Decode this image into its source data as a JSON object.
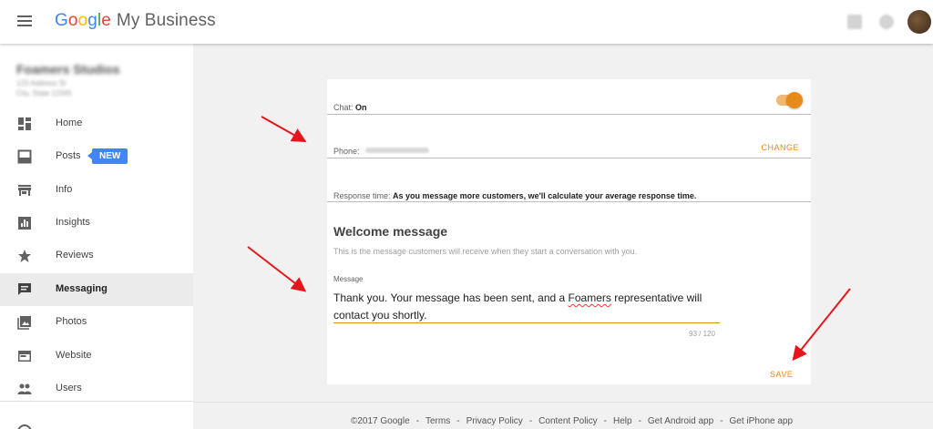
{
  "header": {
    "logo_google": [
      "G",
      "o",
      "o",
      "g",
      "l",
      "e"
    ],
    "product": "My Business",
    "icons": [
      "menu-icon",
      "apps-icon",
      "notifications-icon",
      "avatar"
    ]
  },
  "sidebar": {
    "items": [
      {
        "label": "Home",
        "icon": "dashboard-icon"
      },
      {
        "label": "Posts",
        "icon": "posts-icon",
        "badge": "NEW"
      },
      {
        "label": "Info",
        "icon": "storefront-icon"
      },
      {
        "label": "Insights",
        "icon": "bar-chart-icon"
      },
      {
        "label": "Reviews",
        "icon": "star-icon"
      },
      {
        "label": "Messaging",
        "icon": "chat-icon",
        "active": true
      },
      {
        "label": "Photos",
        "icon": "photo-icon"
      },
      {
        "label": "Website",
        "icon": "web-icon"
      },
      {
        "label": "Users",
        "icon": "people-icon"
      }
    ]
  },
  "card": {
    "chat_label": "Chat:",
    "chat_value": "On",
    "phone_label": "Phone:",
    "change_label": "CHANGE",
    "response_label": "Response time:",
    "response_value": "As you message more customers, we'll calculate your average response time.",
    "welcome_title": "Welcome message",
    "welcome_sub": "This is the message customers will receive when they start a conversation with you.",
    "message_label": "Message",
    "message_before": "Thank you. Your message has been sent, and a ",
    "message_misspelled": "Foamers",
    "message_after": " representative will contact you shortly.",
    "counter": "93 / 120",
    "save_label": "SAVE"
  },
  "footer": {
    "copyright": "©2017 Google",
    "links": [
      "Terms",
      "Privacy Policy",
      "Content Policy",
      "Help",
      "Get Android app",
      "Get iPhone app"
    ]
  },
  "colors": {
    "accent": "#e68a1a",
    "badge": "#4285f4",
    "arrow": "#e8141b"
  }
}
